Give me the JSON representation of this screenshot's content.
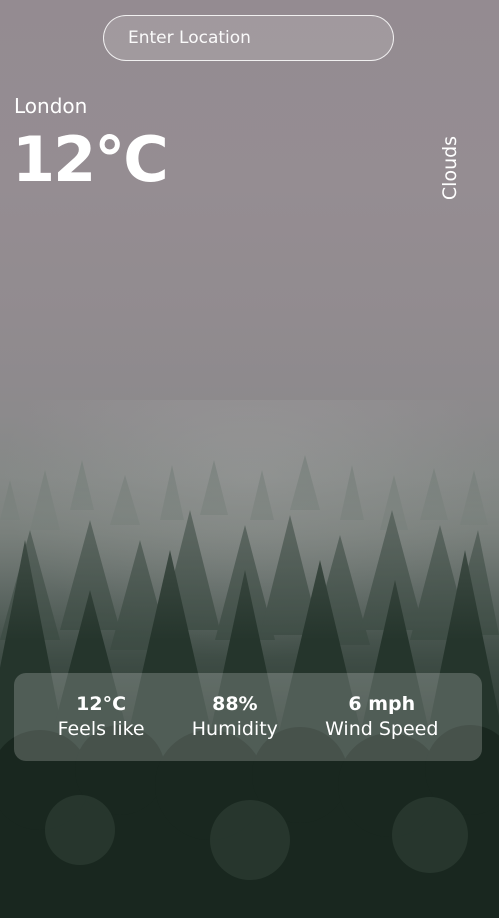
{
  "search": {
    "placeholder": "Enter Location",
    "value": ""
  },
  "weather": {
    "city": "London",
    "temperature": "12°C",
    "condition": "Clouds"
  },
  "stats": [
    {
      "value": "12°C",
      "label": "Feels like"
    },
    {
      "value": "88%",
      "label": "Humidity"
    },
    {
      "value": "6 mph",
      "label": "Wind Speed"
    }
  ],
  "colors": {
    "text": "#ffffff",
    "sky": "#948b91",
    "forest": "#1c2a22"
  },
  "background": {
    "icon": "foggy-forest-image"
  }
}
